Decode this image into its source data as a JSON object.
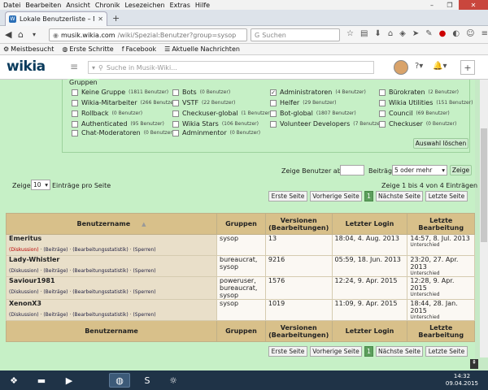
{
  "menubar": {
    "items": [
      "Datei",
      "Bearbeiten",
      "Ansicht",
      "Chronik",
      "Lesezeichen",
      "Extras",
      "Hilfe"
    ]
  },
  "tab": {
    "title": "Lokale Benutzerliste – Musi..."
  },
  "url": {
    "domain": "musik.wikia.com",
    "path": "/wiki/Spezial:Benutzer?group=sysop"
  },
  "browser_search": {
    "placeholder": "Suchen"
  },
  "bookmarks": [
    "Meistbesucht",
    "Erste Schritte",
    "Facebook",
    "Aktuelle Nachrichten"
  ],
  "wiki": {
    "logo": "wikia",
    "search_placeholder": "Suche in Musik-Wiki..."
  },
  "groups": {
    "legend": "Gruppen",
    "items": [
      {
        "label": "Keine Gruppe",
        "count": "(1811 Benutzer)",
        "checked": false
      },
      {
        "label": "Wikia-Mitarbeiter",
        "count": "(266 Benutzer)",
        "checked": false
      },
      {
        "label": "Rollback",
        "count": "(0 Benutzer)",
        "checked": false
      },
      {
        "label": "Authenticated",
        "count": "(95 Benutzer)",
        "checked": false
      },
      {
        "label": "Chat-Moderatoren",
        "count": "(0 Benutzer)",
        "checked": false
      },
      {
        "label": "Bots",
        "count": "(0 Benutzer)",
        "checked": false
      },
      {
        "label": "VSTF",
        "count": "(22 Benutzer)",
        "checked": false
      },
      {
        "label": "Checkuser-global",
        "count": "(1 Benutzer)",
        "checked": false
      },
      {
        "label": "Wikia Stars",
        "count": "(106 Benutzer)",
        "checked": false
      },
      {
        "label": "Adminmentor",
        "count": "(0 Benutzer)",
        "checked": false
      },
      {
        "label": "Administratoren",
        "count": "(4 Benutzer)",
        "checked": true
      },
      {
        "label": "Helfer",
        "count": "(29 Benutzer)",
        "checked": false
      },
      {
        "label": "Bot-global",
        "count": "(1807 Benutzer)",
        "checked": false
      },
      {
        "label": "Volunteer Developers",
        "count": "(7 Benutzer)",
        "checked": false
      },
      {
        "label": "Bürokraten",
        "count": "(2 Benutzer)",
        "checked": false
      },
      {
        "label": "Wikia Utilities",
        "count": "(151 Benutzer)",
        "checked": false
      },
      {
        "label": "Council",
        "count": "(69 Benutzer)",
        "checked": false
      },
      {
        "label": "Checkuser",
        "count": "(0 Benutzer)",
        "checked": false
      }
    ],
    "clear_label": "Auswahl löschen"
  },
  "filter": {
    "show_from_label": "Zeige Benutzer ab:",
    "edits_label": "Beiträge",
    "edits_value": "5 oder mehr",
    "show_button": "Zeige"
  },
  "paging": {
    "show_label": "Zeige",
    "per_page": "10",
    "per_page_label": "Einträge pro Seite",
    "range_text": "Zeige 1 bis 4 von 4 Einträgen",
    "first": "Erste Seite",
    "prev": "Vorherige Seite",
    "current": "1",
    "next": "Nächste Seite",
    "last": "Letzte Seite"
  },
  "table": {
    "headers": [
      "Benutzername",
      "Gruppen",
      "Versionen (Bearbeitungen)",
      "Letzter Login",
      "Letzte Bearbeitung"
    ],
    "link_labels": {
      "discussion": "(Diskussion)",
      "contribs": "(Beiträge)",
      "stats": "(Bearbeitungsstatistik)",
      "block": "(Sperren)",
      "diff": "Unterschied"
    },
    "rows": [
      {
        "name": "Emeritus",
        "groups": "sysop",
        "edits": "13",
        "login": "18:04, 4. Aug. 2013",
        "last_edit": "14:57, 8. Jul. 2013",
        "discussion_red": true
      },
      {
        "name": "Lady-Whistler",
        "groups": "bureaucrat, sysop",
        "edits": "9216",
        "login": "05:59, 18. Jun. 2013",
        "last_edit": "23:20, 27. Apr. 2013",
        "discussion_red": false
      },
      {
        "name": "Saviour1981",
        "groups": "poweruser, bureaucrat, sysop",
        "edits": "1576",
        "login": "12:24, 9. Apr. 2015",
        "last_edit": "12:28, 9. Apr. 2015",
        "discussion_red": false
      },
      {
        "name": "XenonX3",
        "groups": "sysop",
        "edits": "1019",
        "login": "11:09, 9. Apr. 2015",
        "last_edit": "18:44, 28. Jan. 2015",
        "discussion_red": false
      }
    ]
  },
  "taskbar": {
    "time": "14:32",
    "date": "09.04.2015"
  }
}
